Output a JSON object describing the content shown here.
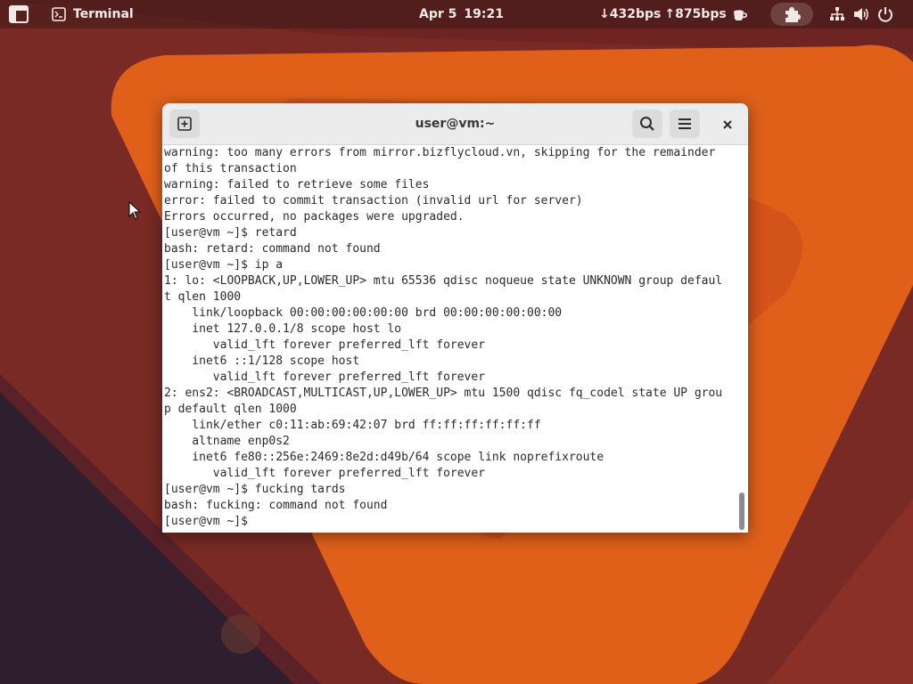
{
  "topbar": {
    "activities_icon": "activities-grid-icon",
    "app_menu": {
      "icon": "terminal-icon",
      "label": "Terminal"
    },
    "clock": {
      "date": "Apr 5",
      "time": "19:21"
    },
    "net_speed": {
      "down": "↓432bps",
      "up": "↑875bps"
    },
    "caffeine_icon": "coffee-cup-icon",
    "extensions_icon": "puzzle-piece-icon",
    "tray_icons": [
      "network-wired-icon",
      "volume-icon",
      "power-icon"
    ]
  },
  "terminal": {
    "title": "user@vm:~",
    "buttons": {
      "new_tab_icon": "new-tab-icon",
      "search_icon": "search-icon",
      "menu_icon": "hamburger-menu-icon",
      "close_icon": "close-icon"
    },
    "lines": [
      "warning: too many errors from mirror.bizflycloud.vn, skipping for the remainder",
      "of this transaction",
      "warning: failed to retrieve some files",
      "error: failed to commit transaction (invalid url for server)",
      "Errors occurred, no packages were upgraded.",
      "[user@vm ~]$ retard",
      "bash: retard: command not found",
      "[user@vm ~]$ ip a",
      "1: lo: <LOOPBACK,UP,LOWER_UP> mtu 65536 qdisc noqueue state UNKNOWN group defaul",
      "t qlen 1000",
      "    link/loopback 00:00:00:00:00:00 brd 00:00:00:00:00:00",
      "    inet 127.0.0.1/8 scope host lo",
      "       valid_lft forever preferred_lft forever",
      "    inet6 ::1/128 scope host",
      "       valid_lft forever preferred_lft forever",
      "2: ens2: <BROADCAST,MULTICAST,UP,LOWER_UP> mtu 1500 qdisc fq_codel state UP grou",
      "p default qlen 1000",
      "    link/ether c0:11:ab:69:42:07 brd ff:ff:ff:ff:ff:ff",
      "    altname enp0s2",
      "    inet6 fe80::256e:2469:8e2d:d49b/64 scope link noprefixroute",
      "       valid_lft forever preferred_lft forever",
      "[user@vm ~]$ fucking tards",
      "bash: fucking: command not found",
      "[user@vm ~]$ "
    ]
  },
  "colors": {
    "wallpaper_base": "#7a2a25",
    "wallpaper_orange": "#e0601a",
    "wallpaper_dark": "#2e1e2e",
    "terminal_bg": "#ffffff",
    "terminal_text": "#2b2b2b",
    "titlebar_bg": "#ececec"
  }
}
